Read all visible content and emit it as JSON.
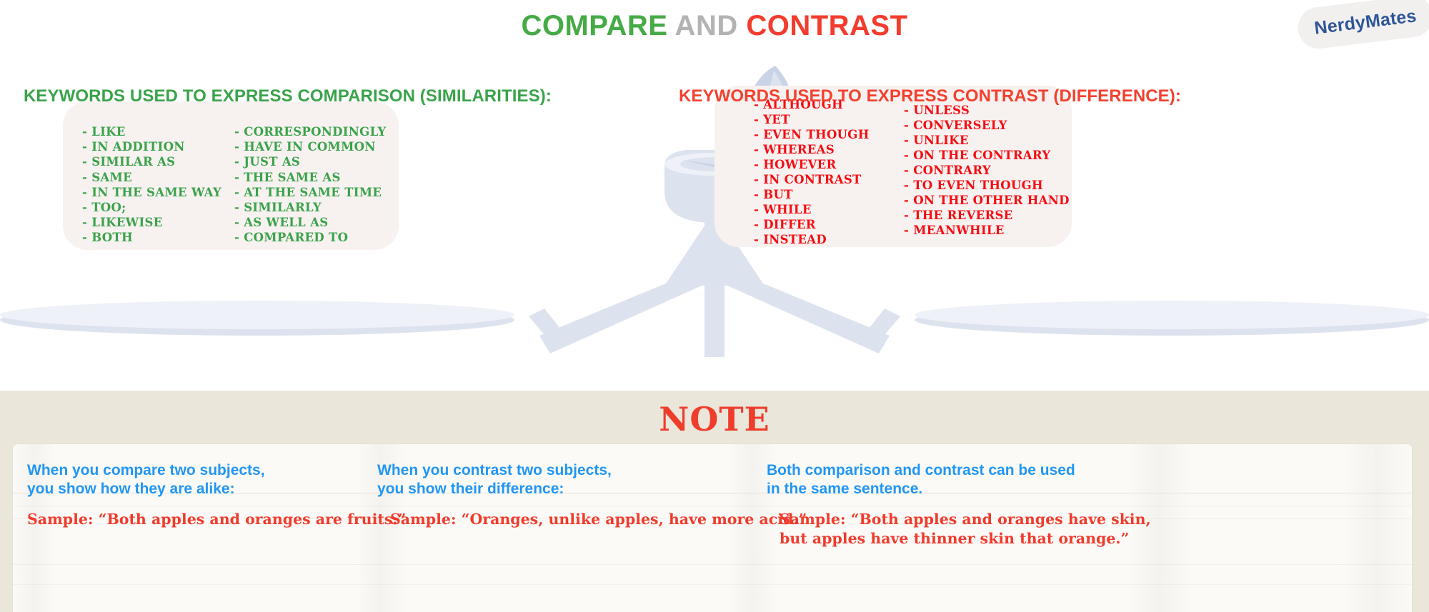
{
  "brand": {
    "name": "NerdyMates",
    "color": "#2e5699"
  },
  "title": {
    "part1": "COMPARE",
    "part2": " AND ",
    "part3": "CONTRAST",
    "color1": "#46aa46",
    "color2": "#b3b3b3",
    "color3": "#f23c2e"
  },
  "compare": {
    "heading": "KEYWORDS USED TO EXPRESS COMPARISON (SIMILARITIES):",
    "color": "#3aa34a",
    "column_1": [
      "- LIKE",
      "- IN ADDITION",
      "- SIMILAR AS",
      "- SAME",
      "- IN THE SAME WAY",
      "- TOO;",
      "- LIKEWISE",
      "- BOTH"
    ],
    "column_2": [
      "- CORRESPONDINGLY",
      "- HAVE IN COMMON",
      "- JUST AS",
      "- THE SAME AS",
      "- AT THE SAME TIME",
      "- SIMILARLY",
      "- AS WELL AS",
      "- COMPARED TO"
    ]
  },
  "contrast": {
    "heading": "KEYWORDS USED TO EXPRESS CONTRAST (DIFFERENCE):",
    "color": "#f4402f",
    "column_1": [
      "- ALTHOUGH",
      "- YET",
      "- EVEN THOUGH",
      "- WHEREAS",
      "- HOWEVER",
      "- IN CONTRAST",
      "- BUT",
      "- WHILE",
      "- DIFFER",
      "- INSTEAD"
    ],
    "column_2": [
      "- UNLESS",
      "- CONVERSELY",
      "- UNLIKE",
      "- ON THE CONTRARY",
      "- CONTRARY",
      "- TO EVEN THOUGH",
      "- ON THE OTHER HAND",
      "- THE REVERSE",
      "- MEANWHILE"
    ]
  },
  "note": {
    "title": "NOTE",
    "title_color": "#ef3d2c",
    "heading_color": "#2196f3",
    "sample_color": "#f03b2c",
    "columns": [
      {
        "heading_line_1": "When you compare two subjects,",
        "heading_line_2": "you show how they are alike:",
        "sample_line_1": "Sample: “Both apples and oranges are fruits.”",
        "sample_line_2": ""
      },
      {
        "heading_line_1": "When you contrast two subjects,",
        "heading_line_2": "you show their difference:",
        "sample_line_1": "Sample: “Oranges, unlike apples, have more acid.”",
        "sample_line_2": ""
      },
      {
        "heading_line_1": "Both comparison and contrast can be used",
        "heading_line_2": "in the same sentence.",
        "sample_line_1": "Sample: “Both apples and oranges have skin,",
        "sample_line_2": "but apples have thinner skin that orange.”"
      }
    ]
  },
  "illustration": {
    "name": "balance-scale-with-quill-and-inkwell",
    "color": "#dde3ee",
    "band_background": "#eae6da",
    "panel_background": "#f7f1f0"
  }
}
